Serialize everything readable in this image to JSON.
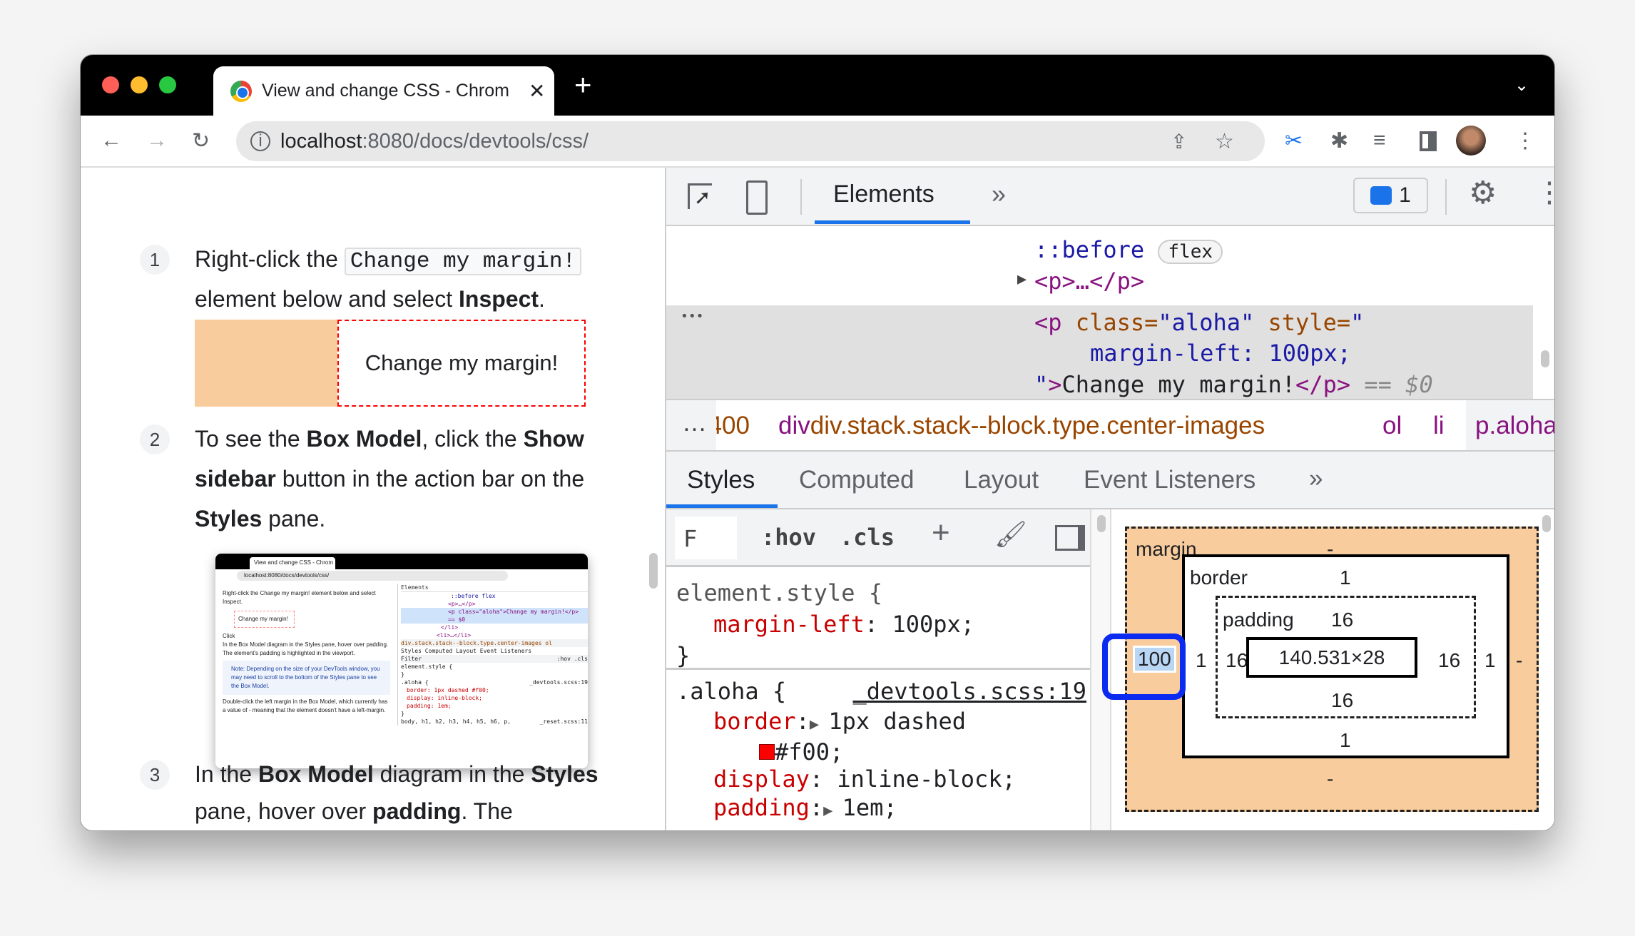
{
  "browser": {
    "tab_title": "View and change CSS - Chrom",
    "url_host": "localhost",
    "url_path": ":8080/docs/devtools/css/",
    "icons": [
      "close-icon",
      "new-tab-icon",
      "chevron-down-icon",
      "back-icon",
      "forward-icon",
      "reload-icon",
      "info-icon",
      "share-icon",
      "star-icon",
      "scissors-icon",
      "extensions-icon",
      "media-icon",
      "side-panel-icon",
      "avatar",
      "kebab-icon"
    ],
    "colors": {
      "close": "#ff5f57",
      "minimize": "#febc2e",
      "maximize": "#28c840"
    }
  },
  "page": {
    "step1": {
      "num": "1",
      "pre": "Right-click the",
      "code": "Change my margin!",
      "line2_pre": "element below and select ",
      "line2_bold": "Inspect",
      "line2_post": "."
    },
    "demo_box": "Change my margin!",
    "step2": {
      "num": "2",
      "l1_pre": "To see the ",
      "l1_b1": "Box Model",
      "l1_mid": ", click the ",
      "l1_b2": "Show",
      "l2_b": "sidebar",
      "l2_post": " button in the action bar on the",
      "l3_b": "Styles",
      "l3_post": " pane."
    },
    "step3": {
      "num": "3",
      "l1_pre": "In the ",
      "l1_b1": "Box Model",
      "l1_mid": " diagram in the ",
      "l1_b2": "Styles",
      "l2_pre": "pane, hover over ",
      "l2_b": "padding",
      "l2_post": ". The"
    },
    "thumbnail": {
      "tab": "View and change CSS - Chrom",
      "url": "localhost:8080/docs/devtools/css/",
      "s1": "Right-click the Change my margin! element below and select Inspect.",
      "box": "Change my margin!",
      "s2": "Click",
      "s3": "In the Box Model diagram in the Styles pane, hover over padding. The element's padding is highlighted in the viewport.",
      "note": "Note: Depending on the size of your DevTools window, you may need to scroll to the bottom of the Styles pane to see the Box Model.",
      "s4": "Double-click the left margin in the Box Model, which currently has a value of - meaning that the element doesn't have a left-margin.",
      "elements": "Elements",
      "code1": "::before flex",
      "code2": "<p>…</p>",
      "code3": "<p class=\"aloha\">Change my margin!</p> == $0",
      "code4": "</li>",
      "code5": "<li>…</li>",
      "crumb": "div.stack.stack--block.type.center-images  ol",
      "tabs": "Styles  Computed  Layout  Event Listeners",
      "filter": "Filter",
      "hov": ":hov .cls",
      "css1": "element.style {",
      "css2": "}",
      "css3": ".aloha {",
      "css3src": "_devtools.scss:19",
      "css4": "border: 1px dashed #f00;",
      "css5": "display: inline-block;",
      "css6": "padding: 1em;",
      "css7": "}",
      "css8": "body, h1, h2, h3, h4, h5, h6, p,",
      "css8src": "_reset.scss:11"
    }
  },
  "devtools": {
    "main_tab": "Elements",
    "more": "»",
    "issues_count": "1",
    "dom": {
      "before": "::before",
      "flex_badge": "flex",
      "p_collapsed": "<p>…</p>",
      "sel_open": "<p",
      "attr_class": " class=",
      "class_val": "\"aloha\"",
      "attr_style": " style=",
      "style_open": "\"",
      "style_body": "margin-left: 100px;",
      "style_close": "\"",
      "gt": ">",
      "text": "Change my margin!",
      "close_tag": "</p>",
      "eq": " == ",
      "dollar": "$0",
      "dots": "•••"
    },
    "breadcrumb": [
      "…",
      "400",
      "div.stack.stack--block.type.center-images",
      "ol",
      "li",
      "p.aloha",
      "…"
    ],
    "side_tabs": [
      "Styles",
      "Computed",
      "Layout",
      "Event Listeners",
      "»"
    ],
    "filter_value": "F",
    "hov": ":hov",
    "cls": ".cls",
    "rules": {
      "element_style": "element.style {",
      "es_prop": "margin-left",
      "es_val": "100px;",
      "close": "}",
      "aloha_sel": ".aloha {",
      "aloha_src": "_devtools.scss:19",
      "border_prop": "border",
      "border_val": "1px dashed",
      "color_val": "#f00;",
      "display_prop": "display",
      "display_val": "inline-block;",
      "padding_prop": "padding",
      "padding_val": "1em;"
    },
    "box_model": {
      "margin_label": "margin",
      "margin_top": "-",
      "margin_right": "-",
      "margin_bottom": "-",
      "margin_left": "100",
      "border_label": "border",
      "border_top": "1",
      "border_right": "1",
      "border_bottom": "1",
      "border_left": "1",
      "padding_label": "padding",
      "padding_top": "16",
      "padding_right": "16",
      "padding_bottom": "16",
      "padding_left": "16",
      "content": "140.531×28"
    },
    "colors": {
      "accent": "#1a73e8",
      "margin": "#f9cc9d",
      "highlight": "#0b2bf0"
    }
  }
}
